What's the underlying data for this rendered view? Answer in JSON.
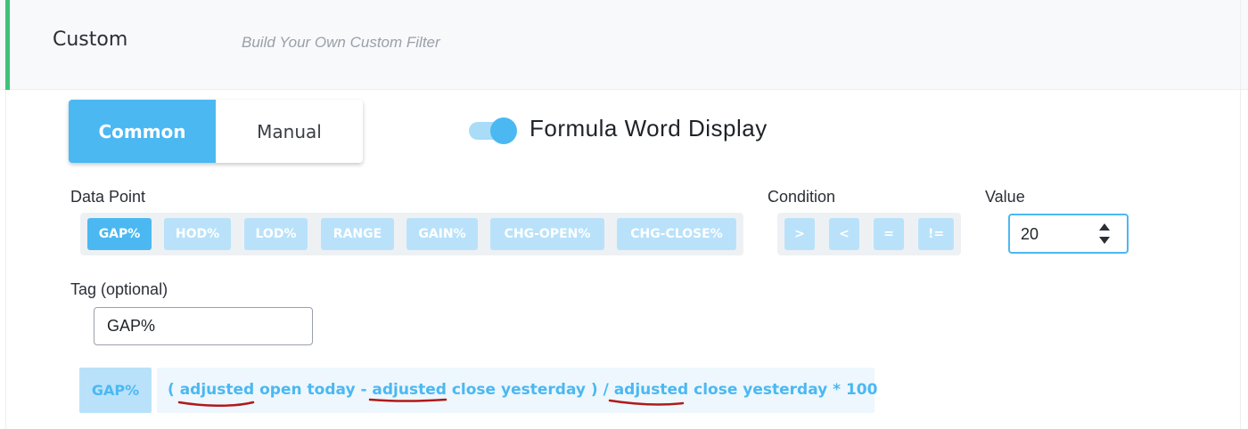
{
  "header": {
    "title": "Custom",
    "subtitle": "Build Your Own Custom Filter"
  },
  "mode_tabs": [
    {
      "label": "Common",
      "active": true
    },
    {
      "label": "Manual",
      "active": false
    }
  ],
  "formula_toggle": {
    "label": "Formula Word Display",
    "on": true
  },
  "data_point": {
    "label": "Data Point",
    "options": [
      "GAP%",
      "HOD%",
      "LOD%",
      "RANGE",
      "GAIN%",
      "CHG-OPEN%",
      "CHG-CLOSE%"
    ],
    "selected": "GAP%"
  },
  "condition": {
    "label": "Condition",
    "options": [
      ">",
      "<",
      "=",
      "!="
    ]
  },
  "value": {
    "label": "Value",
    "current": "20"
  },
  "tag": {
    "label": "Tag (optional)",
    "value": "GAP%"
  },
  "formula": {
    "tag": "GAP%",
    "text": "( adjusted open today - adjusted close yesterday ) / adjusted close yesterday * 100"
  },
  "colors": {
    "accent": "#4bb8f2",
    "accent_light": "#b9e2fa",
    "header_bar": "#3ec27a",
    "annotation": "#b01a1a"
  }
}
